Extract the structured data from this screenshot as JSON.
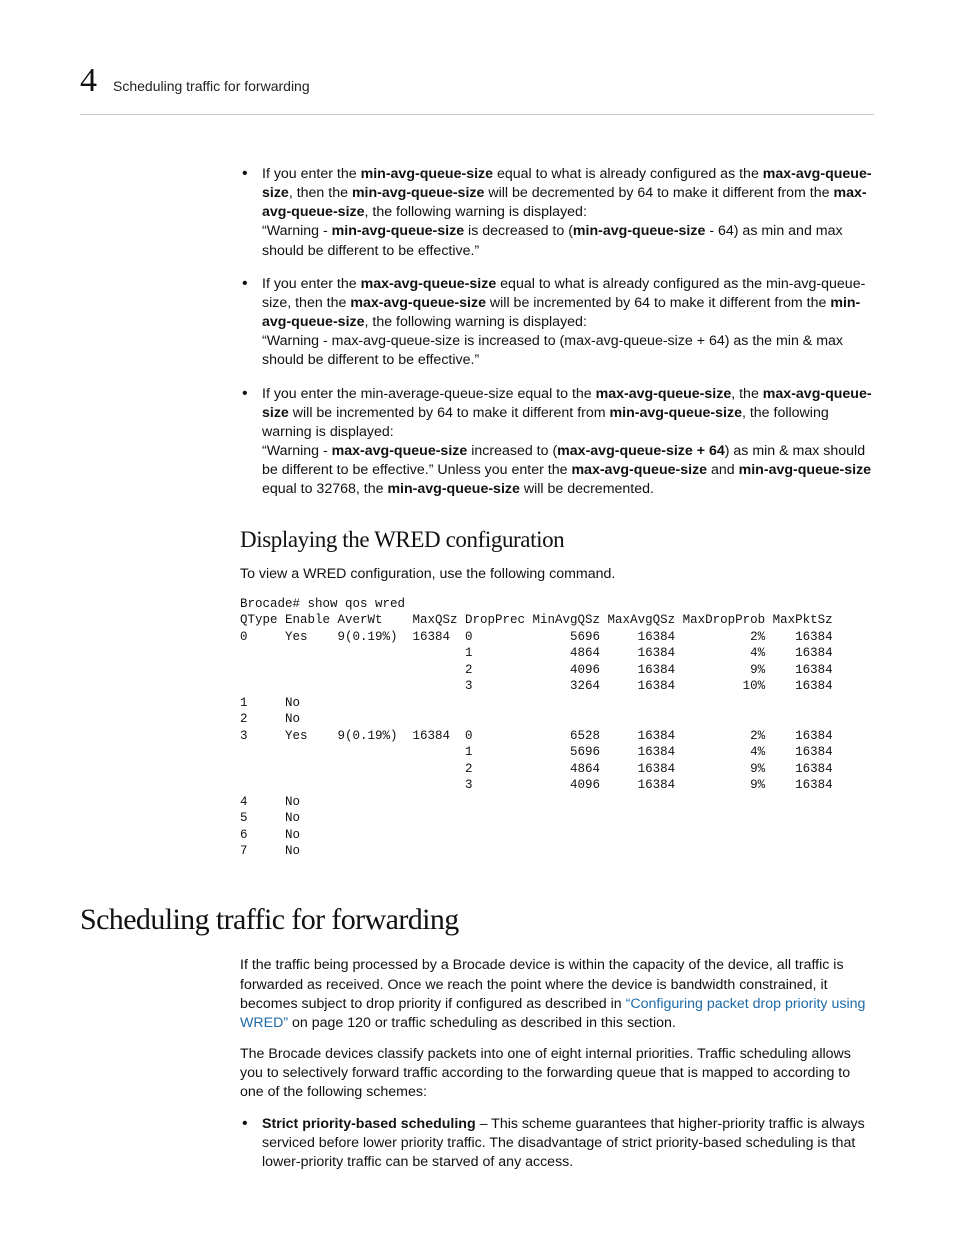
{
  "header": {
    "chapter_number": "4",
    "running_title": "Scheduling traffic for forwarding"
  },
  "bullets": [
    {
      "t1": "If you enter the ",
      "b1": "min-avg-queue-size",
      "t2": " equal to what is already configured as the ",
      "line2a": "max-avg-queue-size",
      "line2b": ", then the ",
      "line2c": "min-avg-queue-size",
      "line2d": " will be decremented by 64 to make it different from the ",
      "line3a": "max-avg-queue-size",
      "line3b": ", the following warning is displayed:",
      "line4a": "“Warning - ",
      "line4b": "min-avg-queue-size",
      "line4c": " is decreased to (",
      "line4d": "min-avg-queue-size",
      "line4e": " - 64) as min and max should be different to be effective.”"
    },
    {
      "t1": "If you enter the ",
      "b1": "max-avg-queue-size",
      "t2": " equal to what is already configured as the min-avg-queue-size, then the ",
      "line2c": "max-avg-queue-size",
      "line2d": " will be incremented by 64 to make it different from the ",
      "line3a": "min-avg-queue-size",
      "line3b": ", the following warning is displayed:",
      "line4a": "“Warning - max-avg-queue-size is increased to (max-avg-queue-size + 64) as the min & max should be different to be effective.”"
    },
    {
      "t1": "If you enter the min-average-queue-size equal to the ",
      "b1": "max-avg-queue-size",
      "t2": ", the ",
      "line2a": "max-avg-queue-size",
      "line2b": " will be incremented by 64 to make it different from ",
      "line3a": "min-avg-queue-size",
      "line3b": ", the following warning is displayed:",
      "line4a": " “Warning - ",
      "line4b": "max-avg-queue-size",
      "line4c": " increased to (",
      "line4d": "max-avg-queue-size + 64",
      "line4e": ") as min & max should be different to be effective.” Unless you enter the ",
      "line5a": "max-avg-queue-size",
      "line5b": " and ",
      "line5c": "min-avg-queue-size",
      "line5d": " equal to 32768, the ",
      "line5e": "min-avg-queue-size",
      "line5f": " will be decremented."
    }
  ],
  "sect_heading": "Displaying the WRED configuration",
  "sect_intro": "To view a WRED configuration, use the following command.",
  "console_output": "Brocade# show qos wred\nQType Enable AverWt    MaxQSz DropPrec MinAvgQSz MaxAvgQSz MaxDropProb MaxPktSz\n0     Yes    9(0.19%)  16384  0             5696     16384          2%    16384\n                              1             4864     16384          4%    16384\n                              2             4096     16384          9%    16384\n                              3             3264     16384         10%    16384\n1     No\n2     No\n3     Yes    9(0.19%)  16384  0             6528     16384          2%    16384\n                              1             5696     16384          4%    16384\n                              2             4864     16384          9%    16384\n                              3             4096     16384          9%    16384\n4     No\n5     No\n6     No\n7     No",
  "chapter_heading": "Scheduling traffic for forwarding",
  "chap_p1_a": "If the traffic being processed by a Brocade device is within the capacity of the device, all traffic is forwarded as received. Once we reach the point where the device is bandwidth constrained, it becomes subject to drop priority if configured as described in ",
  "chap_p1_link": "“Configuring packet drop priority using WRED”",
  "chap_p1_b": " on page 120 or traffic scheduling as described in this section.",
  "chap_p2": "The Brocade devices classify packets into one of eight internal priorities. Traffic scheduling allows you to selectively forward traffic according to the forwarding queue that is mapped to according to one of the following schemes:",
  "chap_bullet": {
    "bold": "Strict priority-based scheduling",
    "rest": " – This scheme guarantees that higher-priority traffic is always serviced before lower priority traffic. The disadvantage of strict priority-based scheduling is that lower-priority traffic can be starved of any access."
  },
  "chart_data": {
    "type": "table",
    "title": "show qos wred",
    "columns": [
      "QType",
      "Enable",
      "AverWt",
      "MaxQSz",
      "DropPrec",
      "MinAvgQSz",
      "MaxAvgQSz",
      "MaxDropProb",
      "MaxPktSz"
    ],
    "rows": [
      [
        "0",
        "Yes",
        "9(0.19%)",
        "16384",
        "0",
        "5696",
        "16384",
        "2%",
        "16384"
      ],
      [
        "",
        "",
        "",
        "",
        "1",
        "4864",
        "16384",
        "4%",
        "16384"
      ],
      [
        "",
        "",
        "",
        "",
        "2",
        "4096",
        "16384",
        "9%",
        "16384"
      ],
      [
        "",
        "",
        "",
        "",
        "3",
        "3264",
        "16384",
        "10%",
        "16384"
      ],
      [
        "1",
        "No",
        "",
        "",
        "",
        "",
        "",
        "",
        ""
      ],
      [
        "2",
        "No",
        "",
        "",
        "",
        "",
        "",
        "",
        ""
      ],
      [
        "3",
        "Yes",
        "9(0.19%)",
        "16384",
        "0",
        "6528",
        "16384",
        "2%",
        "16384"
      ],
      [
        "",
        "",
        "",
        "",
        "1",
        "5696",
        "16384",
        "4%",
        "16384"
      ],
      [
        "",
        "",
        "",
        "",
        "2",
        "4864",
        "16384",
        "9%",
        "16384"
      ],
      [
        "",
        "",
        "",
        "",
        "3",
        "4096",
        "16384",
        "9%",
        "16384"
      ],
      [
        "4",
        "No",
        "",
        "",
        "",
        "",
        "",
        "",
        ""
      ],
      [
        "5",
        "No",
        "",
        "",
        "",
        "",
        "",
        "",
        ""
      ],
      [
        "6",
        "No",
        "",
        "",
        "",
        "",
        "",
        "",
        ""
      ],
      [
        "7",
        "No",
        "",
        "",
        "",
        "",
        "",
        "",
        ""
      ]
    ]
  }
}
